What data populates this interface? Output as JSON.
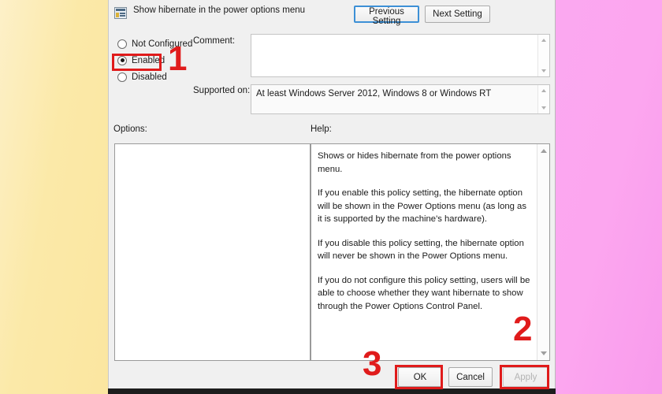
{
  "dialog": {
    "title": "Show hibernate in the power options menu",
    "title_icon": "policy-setting-icon",
    "previous_setting_label": "Previous Setting",
    "next_setting_label": "Next Setting"
  },
  "state_options": {
    "items": [
      {
        "label": "Not Configured",
        "selected": false
      },
      {
        "label": "Enabled",
        "selected": true
      },
      {
        "label": "Disabled",
        "selected": false
      }
    ]
  },
  "comment": {
    "label": "Comment:",
    "value": "",
    "placeholder": ""
  },
  "supported_on": {
    "label": "Supported on:",
    "value": "At least Windows Server 2012, Windows 8 or Windows RT"
  },
  "options_pane": {
    "label": "Options:",
    "value": ""
  },
  "help_pane": {
    "label": "Help:",
    "paragraphs": [
      "Shows or hides hibernate from the power options menu.",
      "If you enable this policy setting, the hibernate option will be shown in the Power Options menu (as long as it is supported by the machine's hardware).",
      "If you disable this policy setting, the hibernate option will never be shown in the Power Options menu.",
      "If you do not configure this policy setting, users will be able to choose whether they want hibernate to show through the Power Options Control Panel."
    ]
  },
  "footer": {
    "ok_label": "OK",
    "cancel_label": "Cancel",
    "apply_label": "Apply"
  },
  "annotations": {
    "color": "#e01b1b",
    "step_1": "1",
    "step_2": "2",
    "step_3": "3"
  },
  "background": {
    "left_color": "#fbe9a8",
    "right_color": "#fca6ef"
  }
}
